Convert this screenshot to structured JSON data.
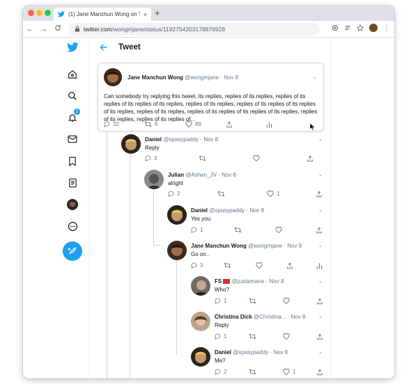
{
  "browser": {
    "tab_title": "(1) Jane Manchun Wong on Twit",
    "tab_close": "×",
    "new_tab": "+",
    "url_host": "twitter.com",
    "url_path": "/wongmjane/status/1192754203178876928",
    "nav_back": "←",
    "nav_forward": "→",
    "nav_reload": "C"
  },
  "header": {
    "title": "Tweet"
  },
  "main_tweet": {
    "name": "Jane Manchun Wong",
    "handle": "@wongmjane",
    "date": "Nov 8",
    "text": "Can somebody try replying this tweet, its replies, replies of its replies, replies of its replies of its replies of its replies, replies of its replies, replies of its replies of its replies of its replies, replies of its replies, replies of its replies of its replies of its replies, replies of its replies, replies of its replies of...",
    "replies": "32",
    "retweets": "6",
    "likes": "89"
  },
  "replies": [
    {
      "name": "Daniel",
      "handle": "@spasypaddy",
      "date": "Nov 8",
      "text": "Reply",
      "replies": "3",
      "likes": ""
    },
    {
      "name": "Julian",
      "handle": "@Ashen_JV",
      "date": "Nov 8",
      "text": "alright",
      "replies": "2",
      "likes": "1"
    },
    {
      "name": "Daniel",
      "handle": "@spasypaddy",
      "date": "Nov 8",
      "text": "Yes you",
      "replies": "1",
      "likes": ""
    },
    {
      "name": "Jane Manchun Wong",
      "handle": "@wongmjane",
      "date": "Nov 8",
      "text": "Go on..",
      "replies": "3",
      "likes": ""
    },
    {
      "name": "FS",
      "handle": "@justaimane",
      "date": "Nov 8",
      "text": "Who?",
      "replies": "1",
      "likes": ""
    },
    {
      "name": "Christina Dick",
      "handle": "@Christina...",
      "date": "Nov 8",
      "text": "Reply",
      "replies": "1",
      "likes": ""
    },
    {
      "name": "Daniel",
      "handle": "@spasypaddy",
      "date": "Nov 8",
      "text": "Me?",
      "replies": "2",
      "likes": "1"
    }
  ],
  "nav": {
    "notification_count": "1"
  },
  "colors": {
    "twitter_blue": "#1da1f2",
    "border": "#e6ecf0",
    "muted": "#657786"
  }
}
